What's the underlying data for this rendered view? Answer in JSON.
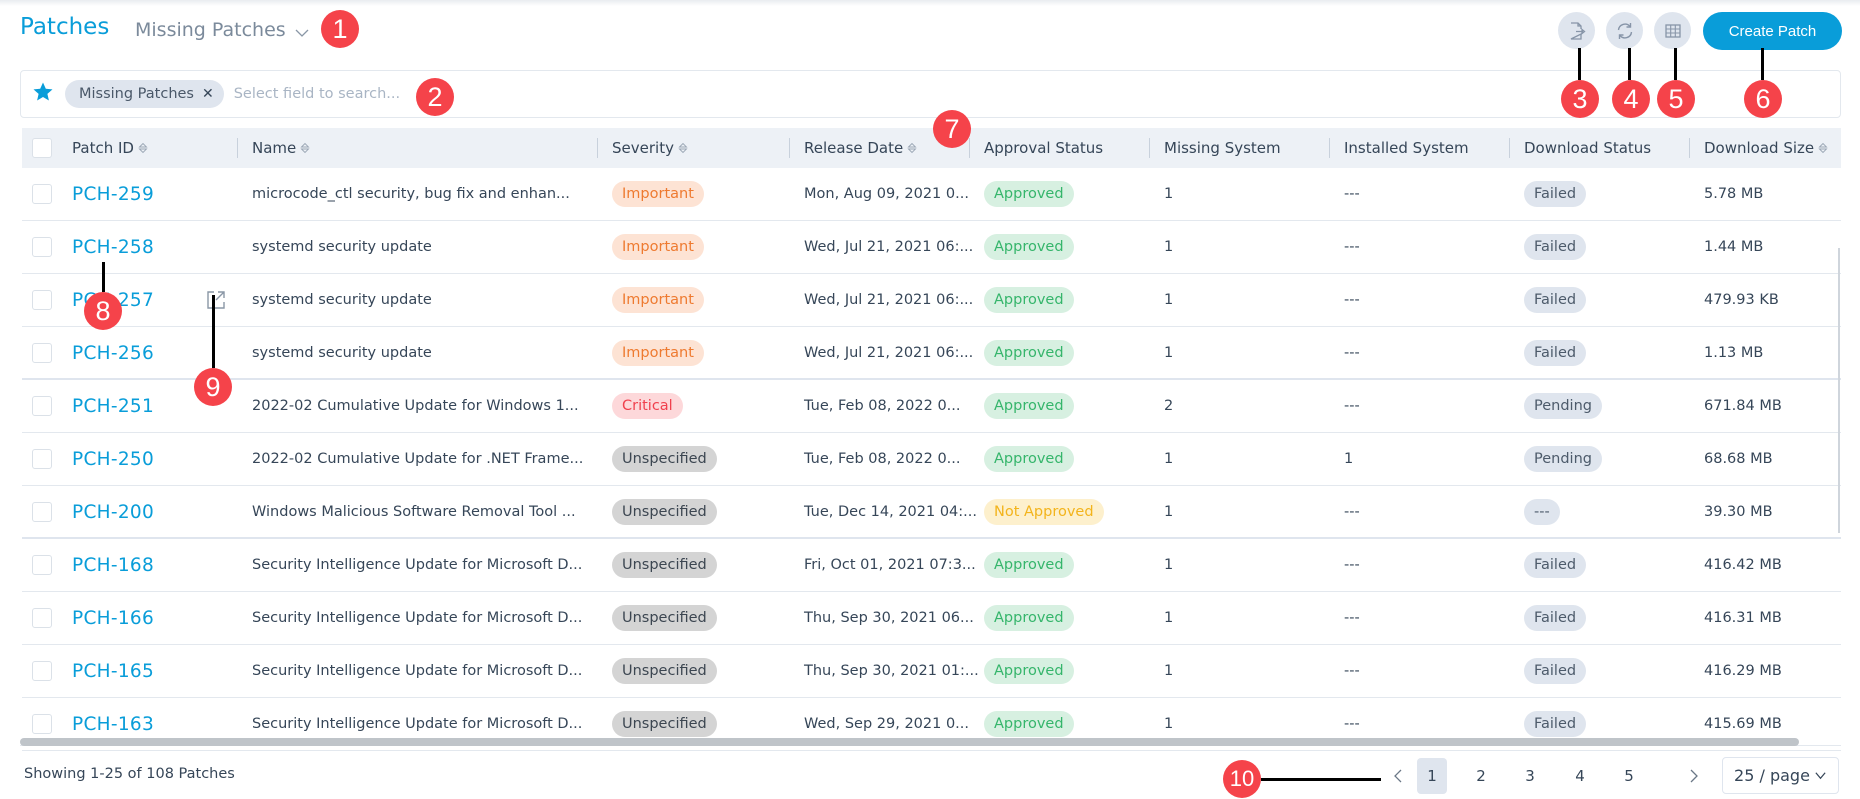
{
  "header": {
    "title": "Patches",
    "view_selector": "Missing Patches",
    "create_button": "Create Patch",
    "icon_buttons": [
      "export-icon",
      "refresh-icon",
      "column-settings-icon"
    ]
  },
  "search": {
    "chip_label": "Missing Patches",
    "placeholder": "Select field to search..."
  },
  "table": {
    "columns": [
      {
        "label": "Patch ID",
        "sortable": true
      },
      {
        "label": "Name",
        "sortable": true
      },
      {
        "label": "Severity",
        "sortable": true
      },
      {
        "label": "Release Date",
        "sortable": true
      },
      {
        "label": "Approval Status",
        "sortable": false
      },
      {
        "label": "Missing System",
        "sortable": false
      },
      {
        "label": "Installed System",
        "sortable": false
      },
      {
        "label": "Download Status",
        "sortable": false
      },
      {
        "label": "Download Size",
        "sortable": true
      }
    ],
    "rows": [
      {
        "id": "PCH-259",
        "name": "microcode_ctl security, bug fix and enhan...",
        "severity": "Important",
        "release_date": "Mon, Aug 09, 2021 0...",
        "approval": "Approved",
        "missing": "1",
        "installed": "---",
        "download_status": "Failed",
        "size": "5.78 MB"
      },
      {
        "id": "PCH-258",
        "name": "systemd security update",
        "severity": "Important",
        "release_date": "Wed, Jul 21, 2021 06:...",
        "approval": "Approved",
        "missing": "1",
        "installed": "---",
        "download_status": "Failed",
        "size": "1.44 MB"
      },
      {
        "id": "PCH-257",
        "name": "systemd security update",
        "severity": "Important",
        "release_date": "Wed, Jul 21, 2021 06:...",
        "approval": "Approved",
        "missing": "1",
        "installed": "---",
        "download_status": "Failed",
        "size": "479.93 KB"
      },
      {
        "id": "PCH-256",
        "name": "systemd security update",
        "severity": "Important",
        "release_date": "Wed, Jul 21, 2021 06:...",
        "approval": "Approved",
        "missing": "1",
        "installed": "---",
        "download_status": "Failed",
        "size": "1.13 MB"
      },
      {
        "id": "PCH-251",
        "name": "2022-02 Cumulative Update for Windows 1...",
        "severity": "Critical",
        "release_date": "Tue, Feb 08, 2022 0...",
        "approval": "Approved",
        "missing": "2",
        "installed": "---",
        "download_status": "Pending",
        "size": "671.84 MB"
      },
      {
        "id": "PCH-250",
        "name": "2022-02 Cumulative Update for .NET Frame...",
        "severity": "Unspecified",
        "release_date": "Tue, Feb 08, 2022 0...",
        "approval": "Approved",
        "missing": "1",
        "installed": "1",
        "download_status": "Pending",
        "size": "68.68 MB"
      },
      {
        "id": "PCH-200",
        "name": "Windows Malicious Software Removal Tool ...",
        "severity": "Unspecified",
        "release_date": "Tue, Dec 14, 2021 04:...",
        "approval": "Not Approved",
        "missing": "1",
        "installed": "---",
        "download_status": "---",
        "size": "39.30 MB"
      },
      {
        "id": "PCH-168",
        "name": "Security Intelligence Update for Microsoft D...",
        "severity": "Unspecified",
        "release_date": "Fri, Oct 01, 2021 07:3...",
        "approval": "Approved",
        "missing": "1",
        "installed": "---",
        "download_status": "Failed",
        "size": "416.42 MB"
      },
      {
        "id": "PCH-166",
        "name": "Security Intelligence Update for Microsoft D...",
        "severity": "Unspecified",
        "release_date": "Thu, Sep 30, 2021 06...",
        "approval": "Approved",
        "missing": "1",
        "installed": "---",
        "download_status": "Failed",
        "size": "416.31 MB"
      },
      {
        "id": "PCH-165",
        "name": "Security Intelligence Update for Microsoft D...",
        "severity": "Unspecified",
        "release_date": "Thu, Sep 30, 2021 01:...",
        "approval": "Approved",
        "missing": "1",
        "installed": "---",
        "download_status": "Failed",
        "size": "416.29 MB"
      },
      {
        "id": "PCH-163",
        "name": "Security Intelligence Update for Microsoft D...",
        "severity": "Unspecified",
        "release_date": "Wed, Sep 29, 2021 0...",
        "approval": "Approved",
        "missing": "1",
        "installed": "---",
        "download_status": "Failed",
        "size": "415.69 MB"
      }
    ]
  },
  "footer": {
    "showing": "Showing 1-25 of 108 Patches",
    "prev": "<",
    "next": ">",
    "pages": [
      "1",
      "2",
      "3",
      "4",
      "5"
    ],
    "current_page": "1",
    "per_page": "25 / page"
  },
  "annotations": [
    "1",
    "2",
    "3",
    "4",
    "5",
    "6",
    "7",
    "8",
    "9",
    "10"
  ],
  "colors": {
    "accent": "#099dd9",
    "important": "#ee7a30",
    "critical": "#f0414e",
    "approved": "#35b56b",
    "not_approved": "#f3b41c",
    "annotation": "#f5434a"
  }
}
